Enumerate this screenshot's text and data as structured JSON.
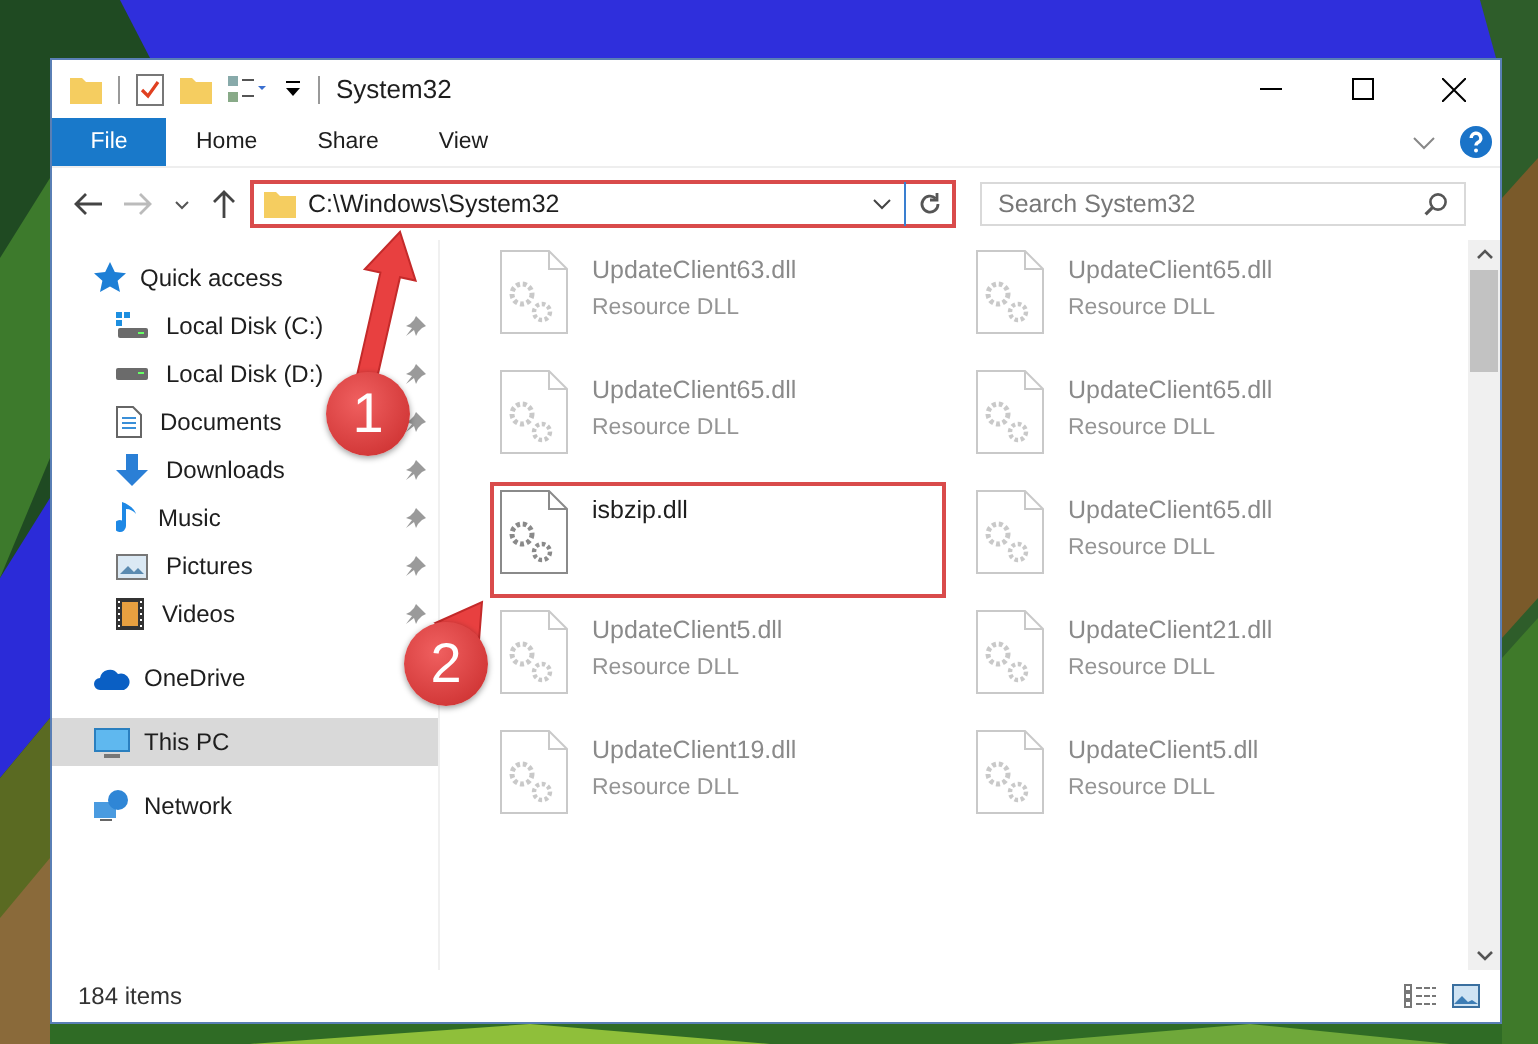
{
  "window": {
    "title": "System32"
  },
  "ribbon_tabs": [
    {
      "label": "File",
      "selected": true
    },
    {
      "label": "Home",
      "selected": false
    },
    {
      "label": "Share",
      "selected": false
    },
    {
      "label": "View",
      "selected": false
    }
  ],
  "address": {
    "value": "C:\\Windows\\System32",
    "highlighted": true
  },
  "search": {
    "placeholder": "Search System32"
  },
  "nav": [
    {
      "label": "Quick access",
      "kind": "star",
      "selected": false,
      "children": [
        {
          "label": "Local Disk (C:)",
          "kind": "system-drive",
          "pinned": true
        },
        {
          "label": "Local Disk (D:)",
          "kind": "drive",
          "pinned": true
        },
        {
          "label": "Documents",
          "kind": "document",
          "pinned": true
        },
        {
          "label": "Downloads",
          "kind": "download",
          "pinned": true
        },
        {
          "label": "Music",
          "kind": "music",
          "pinned": true
        },
        {
          "label": "Pictures",
          "kind": "picture",
          "pinned": true
        },
        {
          "label": "Videos",
          "kind": "video",
          "pinned": true
        }
      ]
    },
    {
      "label": "OneDrive",
      "kind": "cloud",
      "selected": false
    },
    {
      "label": "This PC",
      "kind": "computer",
      "selected": true
    },
    {
      "label": "Network",
      "kind": "network",
      "selected": false
    }
  ],
  "files": [
    {
      "name": "UpdateClient63.dll",
      "type": "Resource DLL",
      "faded": true,
      "highlighted": false
    },
    {
      "name": "UpdateClient65.dll",
      "type": "Resource DLL",
      "faded": true,
      "highlighted": false
    },
    {
      "name": "UpdateClient65.dll",
      "type": "Resource DLL",
      "faded": true,
      "highlighted": false
    },
    {
      "name": "UpdateClient65.dll",
      "type": "Resource DLL",
      "faded": true,
      "highlighted": false
    },
    {
      "name": "isbzip.dll",
      "faded": false,
      "highlighted": true
    },
    {
      "name": "UpdateClient65.dll",
      "type": "Resource DLL",
      "faded": true,
      "highlighted": false
    },
    {
      "name": "UpdateClient5.dll",
      "type": "Resource DLL",
      "faded": true,
      "highlighted": false
    },
    {
      "name": "UpdateClient21.dll",
      "type": "Resource DLL",
      "faded": true,
      "highlighted": false
    },
    {
      "name": "UpdateClient19.dll",
      "type": "Resource DLL",
      "faded": true,
      "highlighted": false
    },
    {
      "name": "UpdateClient5.dll",
      "type": "Resource DLL",
      "faded": true,
      "highlighted": false
    }
  ],
  "status_bar": {
    "count": "184 items"
  },
  "annotations": [
    {
      "number": "1"
    },
    {
      "number": "2"
    }
  ]
}
